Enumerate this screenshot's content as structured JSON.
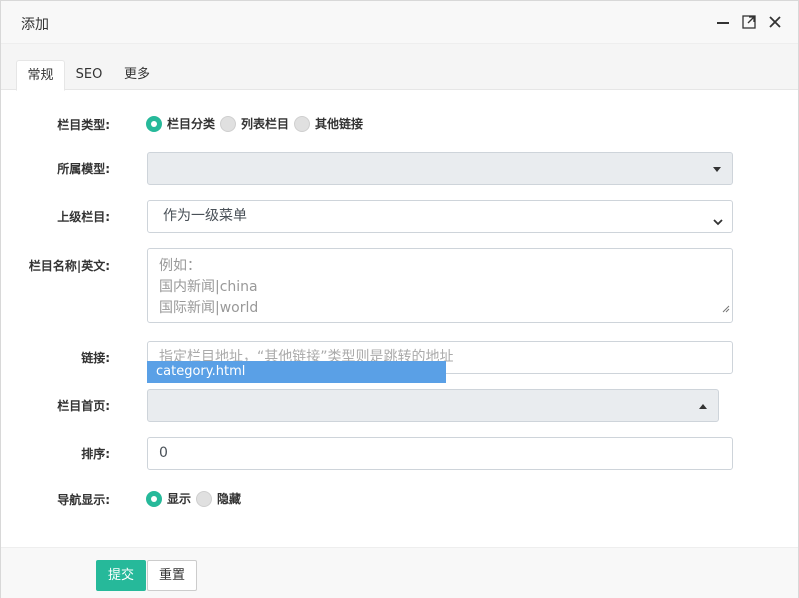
{
  "dialog": {
    "title": "添加",
    "controls": {
      "minimize_icon": "minimize-icon",
      "maximize_icon": "maximize-icon",
      "close_icon": "close-icon"
    }
  },
  "tabs": [
    {
      "label": "常规",
      "active": true
    },
    {
      "label": "SEO",
      "active": false
    },
    {
      "label": "更多",
      "active": false
    }
  ],
  "form": {
    "category_type": {
      "label": "栏目类型:",
      "options": [
        {
          "label": "栏目分类",
          "checked": true
        },
        {
          "label": "列表栏目",
          "checked": false
        },
        {
          "label": "其他链接",
          "checked": false
        }
      ]
    },
    "model": {
      "label": "所属模型:",
      "value": ""
    },
    "parent": {
      "label": "上级栏目:",
      "value": "作为一级菜单"
    },
    "name": {
      "label": "栏目名称|英文:",
      "placeholder_lines": [
        "例如：",
        "国内新闻|china",
        "国际新闻|world"
      ]
    },
    "link": {
      "label": "链接:",
      "placeholder": "指定栏目地址，“其他链接”类型则是跳转的地址"
    },
    "autocomplete": {
      "suggestion": "category.html"
    },
    "index_page": {
      "label": "栏目首页:",
      "value": ""
    },
    "sort": {
      "label": "排序:",
      "value": "0"
    },
    "nav_display": {
      "label": "导航显示:",
      "options": [
        {
          "label": "显示",
          "checked": true
        },
        {
          "label": "隐藏",
          "checked": false
        }
      ]
    }
  },
  "footer": {
    "submit_label": "提交",
    "reset_label": "重置"
  },
  "colors": {
    "accent": "#26b99a",
    "autocomplete_bg": "#5aa0e6"
  }
}
